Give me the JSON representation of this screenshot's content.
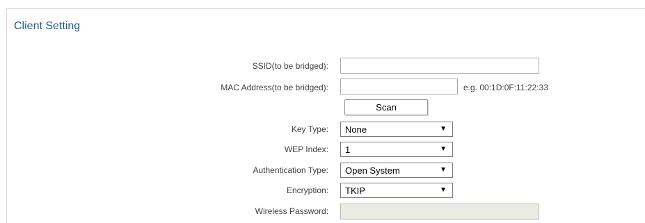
{
  "section": {
    "title": "Client Setting"
  },
  "form": {
    "ssid": {
      "label": "SSID(to be bridged):",
      "value": ""
    },
    "mac": {
      "label": "MAC Address(to be bridged):",
      "value": "",
      "hint": "e.g. 00:1D:0F:11:22:33"
    },
    "scan_button": "Scan",
    "key_type": {
      "label": "Key Type:",
      "value": "None"
    },
    "wep_index": {
      "label": "WEP Index:",
      "value": "1"
    },
    "auth_type": {
      "label": "Authentication Type:",
      "value": "Open System"
    },
    "encryption": {
      "label": "Encryption:",
      "value": "TKIP"
    },
    "password": {
      "label": "Wireless Password:",
      "value": ""
    }
  },
  "icons": {
    "dropdown_caret": "▼"
  }
}
